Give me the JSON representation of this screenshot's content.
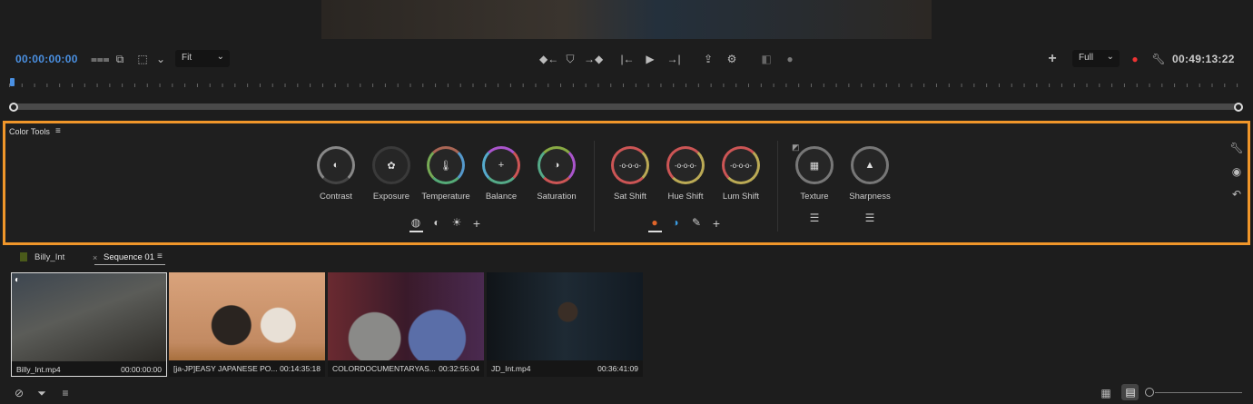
{
  "monitor": {
    "timecode_in": "00:00:00:00",
    "fit_select": "Fit",
    "quality_select": "Full",
    "timecode_duration": "00:49:13:22",
    "icons": [
      "settings-sliders",
      "overlay",
      "safe-margins",
      "mark-in",
      "add-marker",
      "mark-out",
      "go-to-in",
      "play",
      "go-to-out",
      "export-frame",
      "proxy-toggle",
      "comparison-view",
      "lumetri-scope",
      "add-button",
      "color-channels",
      "wrench"
    ]
  },
  "color_tools": {
    "title": "Color Tools",
    "basic": [
      {
        "label": "Contrast"
      },
      {
        "label": "Exposure"
      },
      {
        "label": "Temperature"
      },
      {
        "label": "Balance"
      },
      {
        "label": "Saturation"
      }
    ],
    "hsl": [
      {
        "label": "Sat Shift"
      },
      {
        "label": "Hue Shift"
      },
      {
        "label": "Lum Shift"
      }
    ],
    "detail": [
      {
        "label": "Texture"
      },
      {
        "label": "Sharpness"
      }
    ],
    "accent": "#f0962a"
  },
  "project": {
    "tabs": [
      {
        "label": "Billy_Int"
      },
      {
        "label": "Sequence 01",
        "close": "×"
      }
    ],
    "clips": [
      {
        "name": "Billy_Int.mp4",
        "duration": "00:00:00:00"
      },
      {
        "name": "[ja-JP]EASY JAPANESE PO...",
        "duration": "00:14:35:18"
      },
      {
        "name": "COLORDOCUMENTARYAS...",
        "duration": "00:32:55:04"
      },
      {
        "name": "JD_Int.mp4",
        "duration": "00:36:41:09"
      }
    ]
  }
}
